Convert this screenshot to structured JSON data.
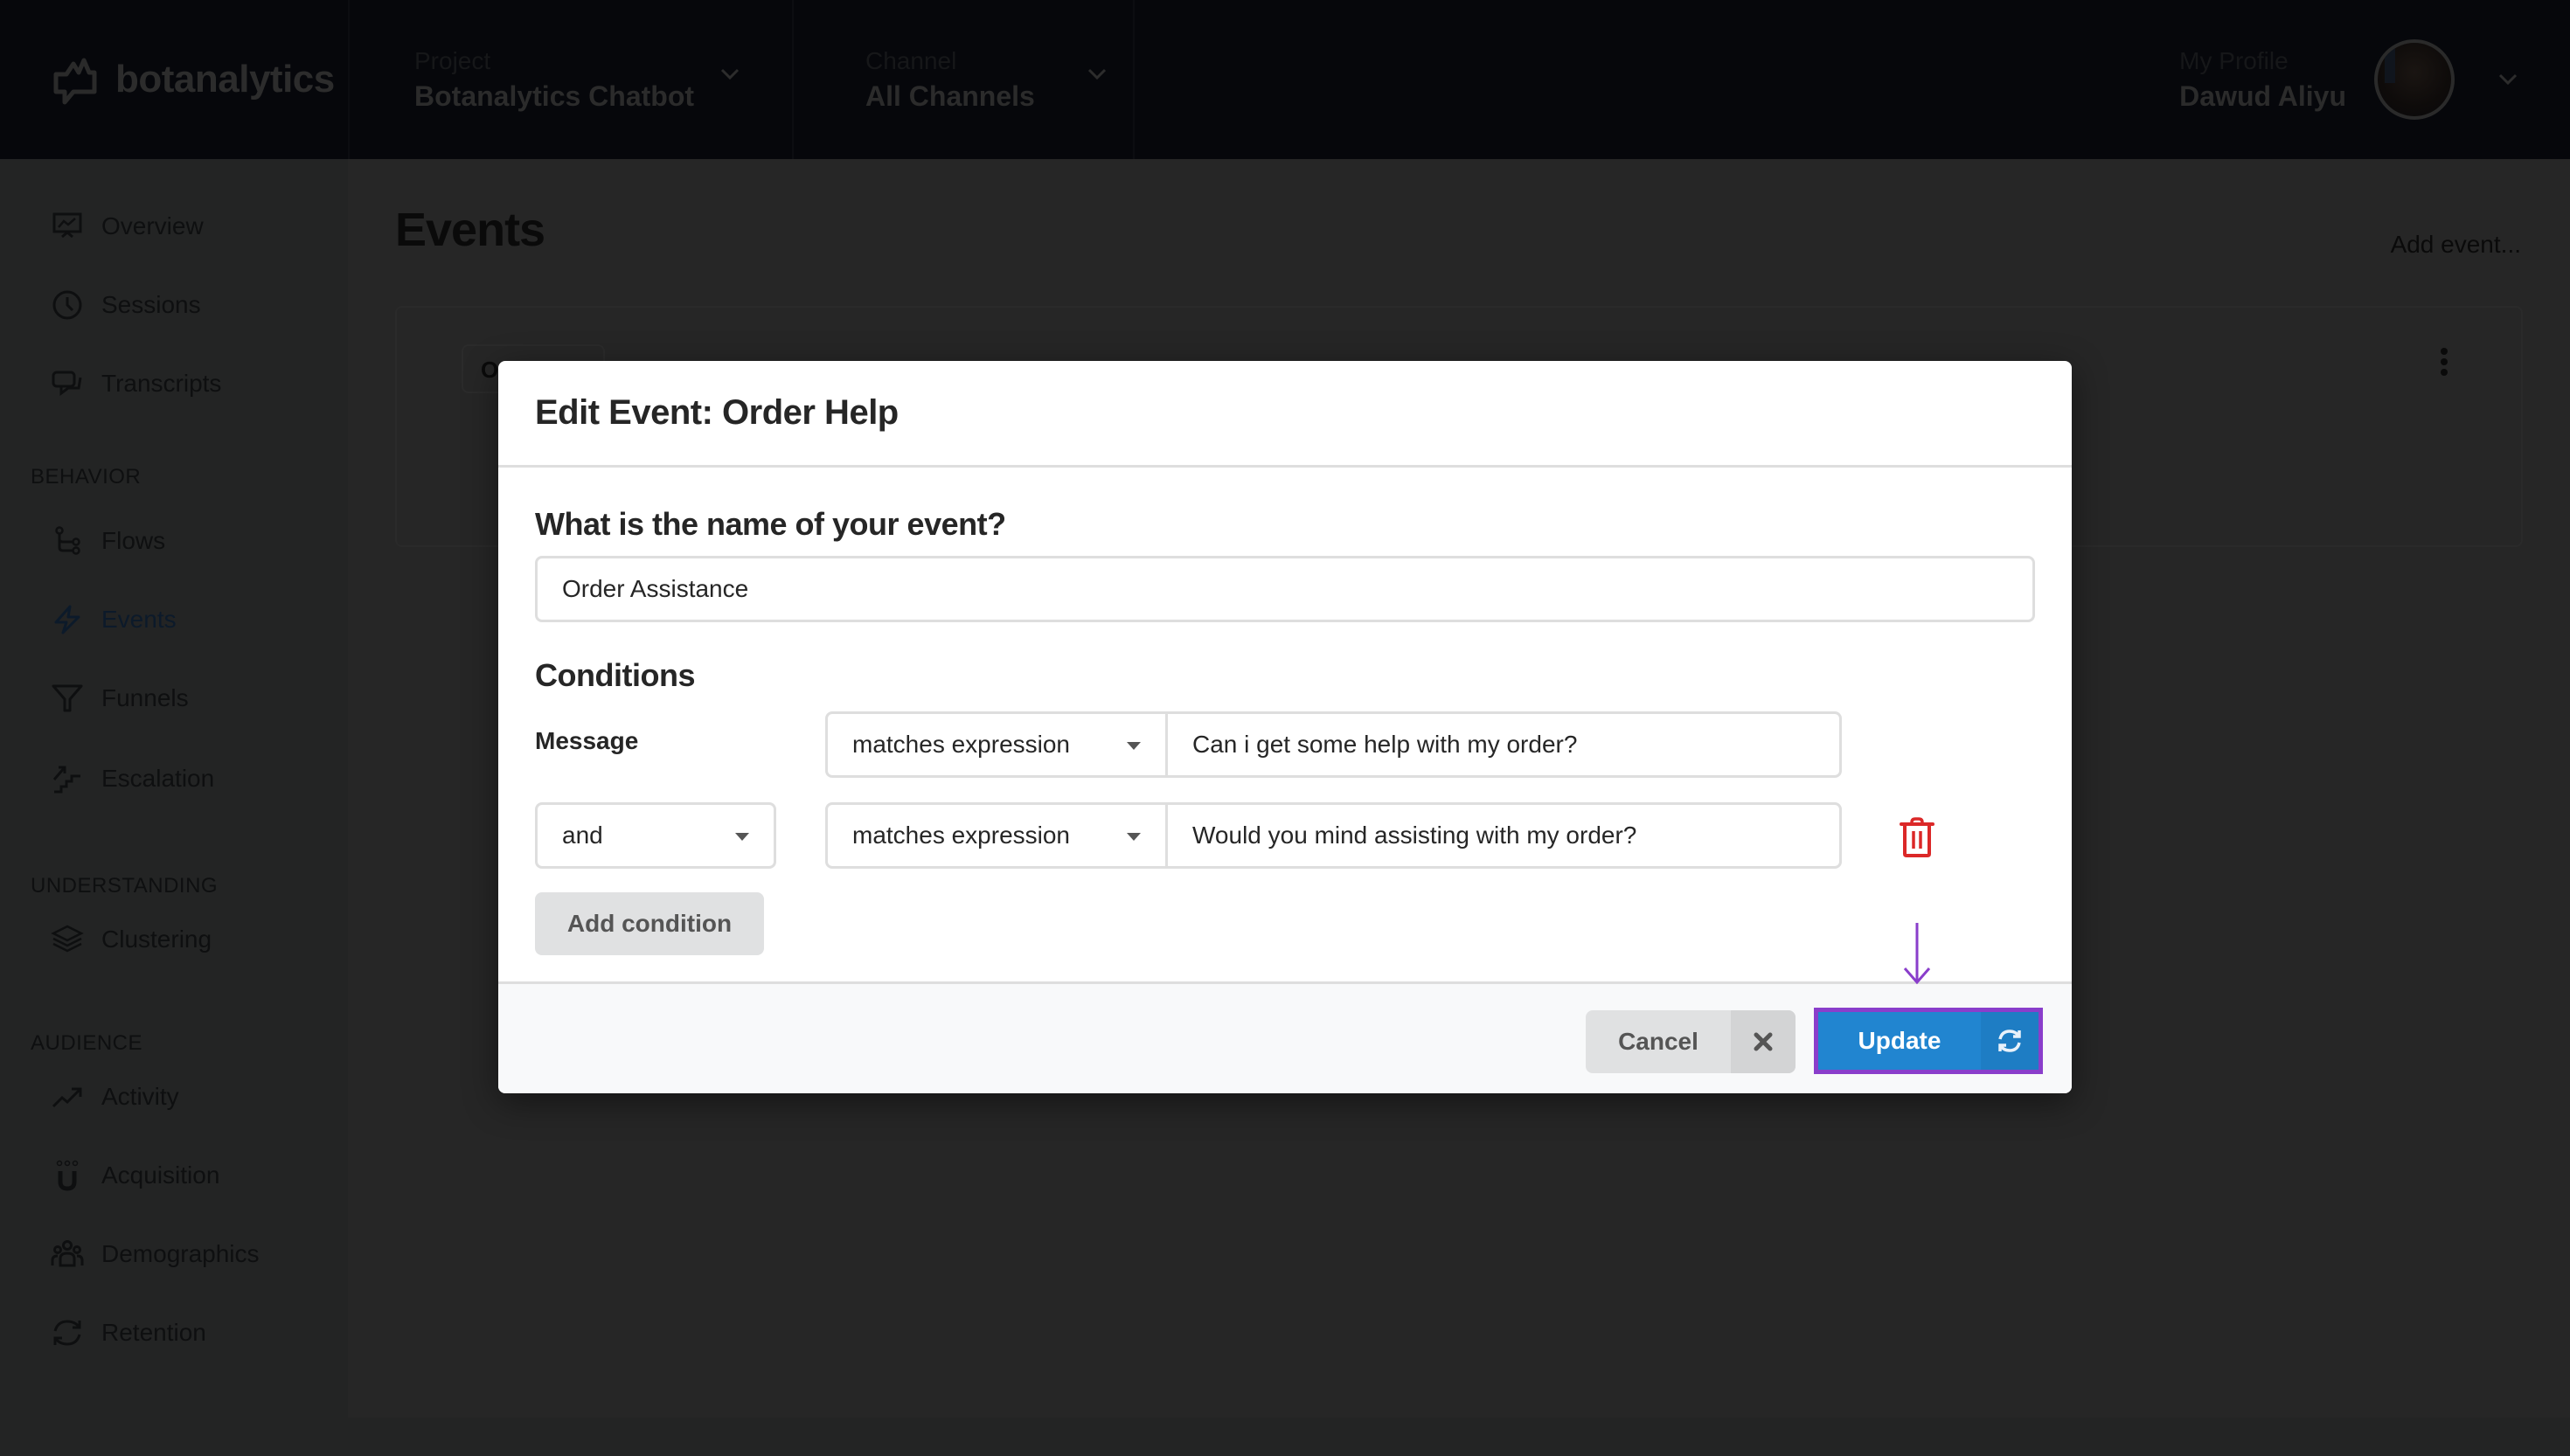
{
  "app": {
    "logo_text": "botanalytics",
    "project": {
      "label": "Project",
      "value": "Botanalytics Chatbot"
    },
    "channel": {
      "label": "Channel",
      "value": "All Channels"
    },
    "profile": {
      "label": "My Profile",
      "name": "Dawud Aliyu"
    }
  },
  "sidebar": {
    "items_top": [
      {
        "label": "Overview",
        "icon": "presentation-chart-icon"
      },
      {
        "label": "Sessions",
        "icon": "clock-icon"
      },
      {
        "label": "Transcripts",
        "icon": "chat-bubbles-icon"
      }
    ],
    "sections": [
      {
        "title": "BEHAVIOR",
        "items": [
          {
            "label": "Flows",
            "icon": "flow-branch-icon"
          },
          {
            "label": "Events",
            "icon": "lightning-icon",
            "active": true
          },
          {
            "label": "Funnels",
            "icon": "funnel-icon"
          },
          {
            "label": "Escalation",
            "icon": "stairs-arrow-icon"
          }
        ]
      },
      {
        "title": "UNDERSTANDING",
        "items": [
          {
            "label": "Clustering",
            "icon": "layers-icon"
          }
        ]
      },
      {
        "title": "AUDIENCE",
        "items": [
          {
            "label": "Activity",
            "icon": "trending-up-icon"
          },
          {
            "label": "Acquisition",
            "icon": "magnet-users-icon"
          },
          {
            "label": "Demographics",
            "icon": "users-group-icon"
          },
          {
            "label": "Retention",
            "icon": "refresh-icon"
          }
        ]
      }
    ]
  },
  "page": {
    "title": "Events",
    "add_event_label": "Add event...",
    "event_chip_text": "Or"
  },
  "modal": {
    "title": "Edit Event: Order Help",
    "name_question": "What is the name of your event?",
    "name_value": "Order Assistance",
    "conditions_title": "Conditions",
    "first_row_label": "Message",
    "conditions": [
      {
        "join": null,
        "operator": "matches expression",
        "value": "Can i get some help with my order?"
      },
      {
        "join": "and",
        "operator": "matches expression",
        "value": "Would you mind assisting with my order?"
      }
    ],
    "add_condition_label": "Add condition",
    "cancel_label": "Cancel",
    "update_label": "Update"
  },
  "colors": {
    "primary": "#2185d0",
    "danger": "#db2828",
    "highlight": "#8a3ecb"
  }
}
